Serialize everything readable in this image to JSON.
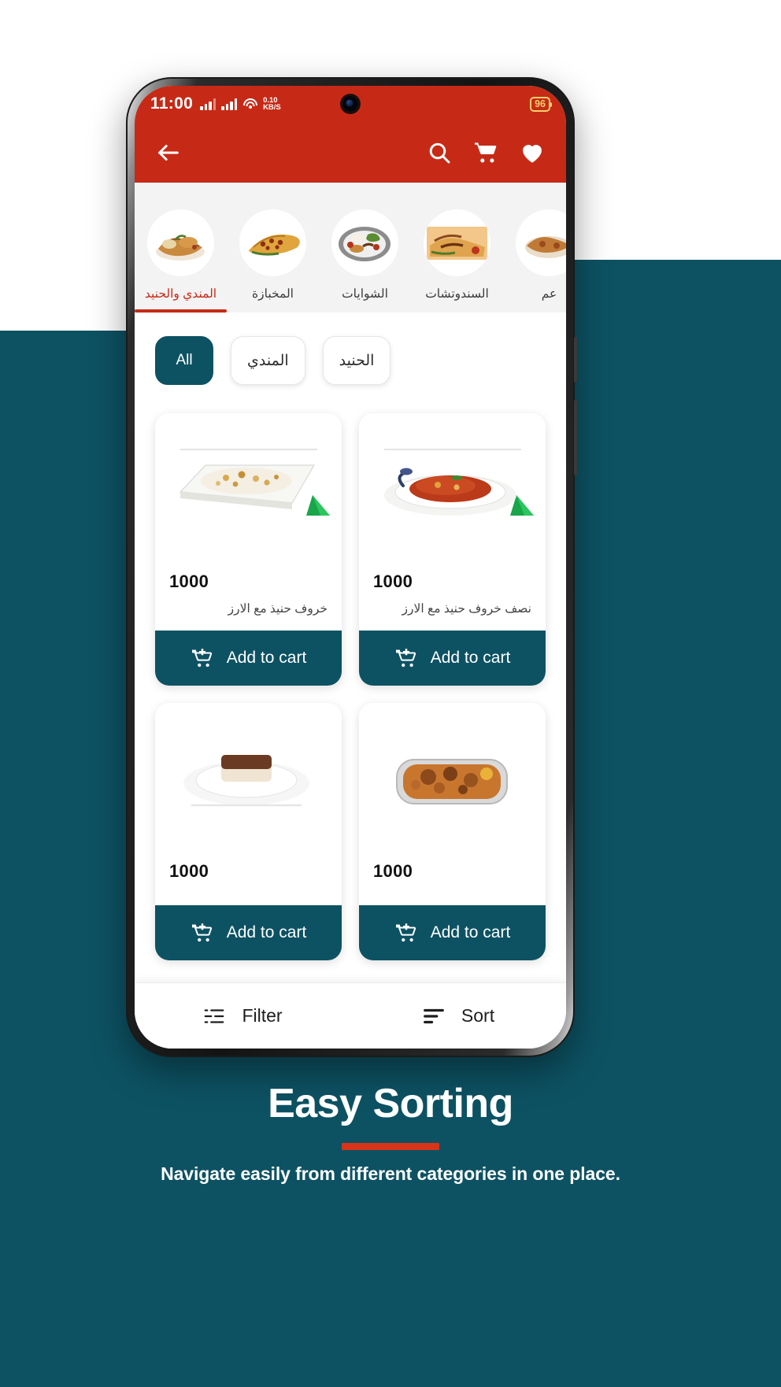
{
  "statusbar": {
    "time": "11:00",
    "net_speed_value": "0.10",
    "net_speed_unit": "KB/S",
    "battery": "96"
  },
  "appbar": {
    "back_label": "back-arrow",
    "search_label": "search",
    "cart_label": "cart",
    "favorites_label": "favorites"
  },
  "categories": [
    {
      "label": "المندي والحنيد",
      "active": true
    },
    {
      "label": "المخبازة",
      "active": false
    },
    {
      "label": "الشوايات",
      "active": false
    },
    {
      "label": "السندوتشات",
      "active": false
    },
    {
      "label": "عم",
      "active": false
    }
  ],
  "chips": [
    {
      "label": "All",
      "active": true
    },
    {
      "label": "المندي",
      "active": false
    },
    {
      "label": "الحنيد",
      "active": false
    }
  ],
  "products": [
    {
      "price": "1000",
      "name": "خروف حنيذ مع الارز",
      "add_label": "Add to cart"
    },
    {
      "price": "1000",
      "name": "نصف خروف حنيذ مع الارز",
      "add_label": "Add to cart"
    },
    {
      "price": "1000",
      "name": "",
      "add_label": "Add to cart"
    },
    {
      "price": "1000",
      "name": "",
      "add_label": "Add to cart"
    }
  ],
  "bottombar": {
    "filter_label": "Filter",
    "sort_label": "Sort"
  },
  "marketing": {
    "headline": "Easy Sorting",
    "subline": "Navigate easily from different categories in one place."
  },
  "colors": {
    "brand_red": "#c62a16",
    "brand_teal": "#0d5263",
    "accent_red": "#d8341a",
    "battery_yellow": "#f3d06a"
  }
}
